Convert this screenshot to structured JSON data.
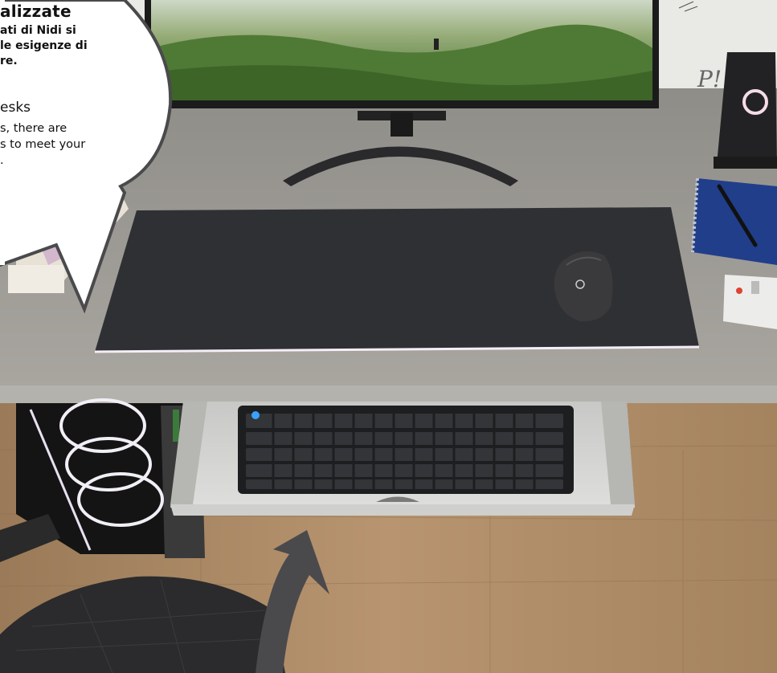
{
  "callout": {
    "title_it": "alizzate",
    "body_it": [
      "ati di Nidi si",
      " le esigenze di",
      "re."
    ],
    "title_en": "esks",
    "body_en": [
      "s, there are",
      "s to meet your",
      "."
    ]
  },
  "scene": {
    "objects": [
      "monitor",
      "speaker",
      "notebook",
      "pen",
      "calculator",
      "desk-mat",
      "mouse",
      "keyboard",
      "keyboard-drawer",
      "pc-case",
      "chair",
      "arrow",
      "books"
    ],
    "colors": {
      "desk": "#9c9a95",
      "mat": "#2f3033",
      "floor": "#b08d68",
      "arrow": "#4a4a4c"
    }
  }
}
